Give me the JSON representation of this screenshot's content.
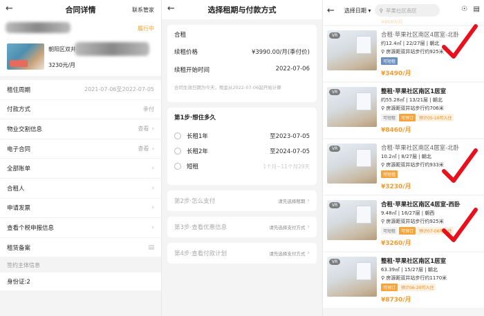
{
  "panel1": {
    "title": "合同详情",
    "contact": "联系管家",
    "status": "履行中",
    "address_prefix": "朝阳区双井",
    "price": "3230元/月",
    "rows": [
      {
        "label": "租住周期",
        "value": "2021-07-06至2022-07-05",
        "chevron": false
      },
      {
        "label": "付款方式",
        "value": "季付",
        "chevron": false
      },
      {
        "label": "物业交割信息",
        "value": "查看",
        "chevron": true
      },
      {
        "label": "电子合同",
        "value": "查看",
        "chevron": true
      },
      {
        "label": "全部账单",
        "value": "",
        "chevron": true
      },
      {
        "label": "合租人",
        "value": "",
        "chevron": true
      },
      {
        "label": "申请发票",
        "value": "",
        "chevron": true
      },
      {
        "label": "查看个税申报信息",
        "value": "",
        "chevron": true
      },
      {
        "label": "租赁备案",
        "value": "",
        "chevron": false
      }
    ],
    "section": "签约主体信息",
    "id_label": "身份证:2"
  },
  "panel2": {
    "title": "选择租期与付款方式",
    "card_title": "合租",
    "renew_price_label": "续租价格",
    "renew_price_value": "¥3990.00/月(季付价)",
    "renew_start_label": "续租开始时间",
    "renew_start_value": "2022-07-06",
    "note": "合同生效日期为今天，租金从2022-07-06起开始计算",
    "step1": "第1步·想住多久",
    "options": [
      {
        "label": "长租1年",
        "value": "至2023-07-05"
      },
      {
        "label": "长租2年",
        "value": "至2024-07-05"
      },
      {
        "label": "短租",
        "value": "1个月~11个月29天"
      }
    ],
    "steps": [
      {
        "label": "第2步·怎么支付",
        "hint": "请先选择租期"
      },
      {
        "label": "第3步·查看优惠信息",
        "hint": "请先选择支付方式"
      },
      {
        "label": "第4步·查看付款计划",
        "hint": "请先选择支付方式"
      }
    ]
  },
  "panel3": {
    "date_select": "选择日期 ▾",
    "search_placeholder": "苹果社区南区",
    "top_price": "¥4680/月",
    "listings": [
      {
        "title": "合租·苹果社区南区4居室-北卧",
        "specs": "约12.4㎡ | 22/27层 | 朝北",
        "dist": "房源距双井站步行约925米",
        "tags": [
          {
            "t": "可短租",
            "c": "blue"
          }
        ],
        "price": "¥3490/月",
        "grey": true,
        "check": true
      },
      {
        "title": "整租·苹果社区南区1居室",
        "specs": "约55.28㎡ | 13/21层 | 朝北",
        "dist": "房源距双井站步行约706米",
        "tags": [
          {
            "t": "可短租",
            "c": "grey"
          },
          {
            "t": "可预订",
            "c": "orange"
          },
          {
            "t": "预计05-10可入住",
            "c": "orangeLight"
          }
        ],
        "price": "¥8460/月",
        "grey": false,
        "check": false
      },
      {
        "title": "合租·苹果社区南区4居室-北卧",
        "specs": "10.2㎡ | 8/27层 | 朝北",
        "dist": "房源距双井站步行约933米",
        "tags": [
          {
            "t": "可短租",
            "c": "orange"
          }
        ],
        "price": "¥3230/月",
        "grey": true,
        "check": true
      },
      {
        "title": "合租·苹果社区南区4居室-西卧",
        "specs": "9.48㎡ | 16/27层 | 朝西",
        "dist": "房源距双井站步行约925米",
        "tags": [
          {
            "t": "可短租",
            "c": "grey"
          },
          {
            "t": "可预订",
            "c": "orange"
          },
          {
            "t": "预计07-06可入住",
            "c": "orangeLight"
          }
        ],
        "price": "¥3260/月",
        "grey": false,
        "check": true
      },
      {
        "title": "整租·苹果社区南区1居室",
        "specs": "63.39㎡ | 15/27层 | 朝北",
        "dist": "房源距双井站步行约1170米",
        "tags": [
          {
            "t": "可预订",
            "c": "orange"
          },
          {
            "t": "预计06-20可入住",
            "c": "orangeLight"
          }
        ],
        "price": "¥8730/月",
        "grey": false,
        "check": false
      }
    ],
    "vr": "VR",
    "colors": {
      "price": "#f29a2e",
      "check": "#e8101c"
    }
  }
}
